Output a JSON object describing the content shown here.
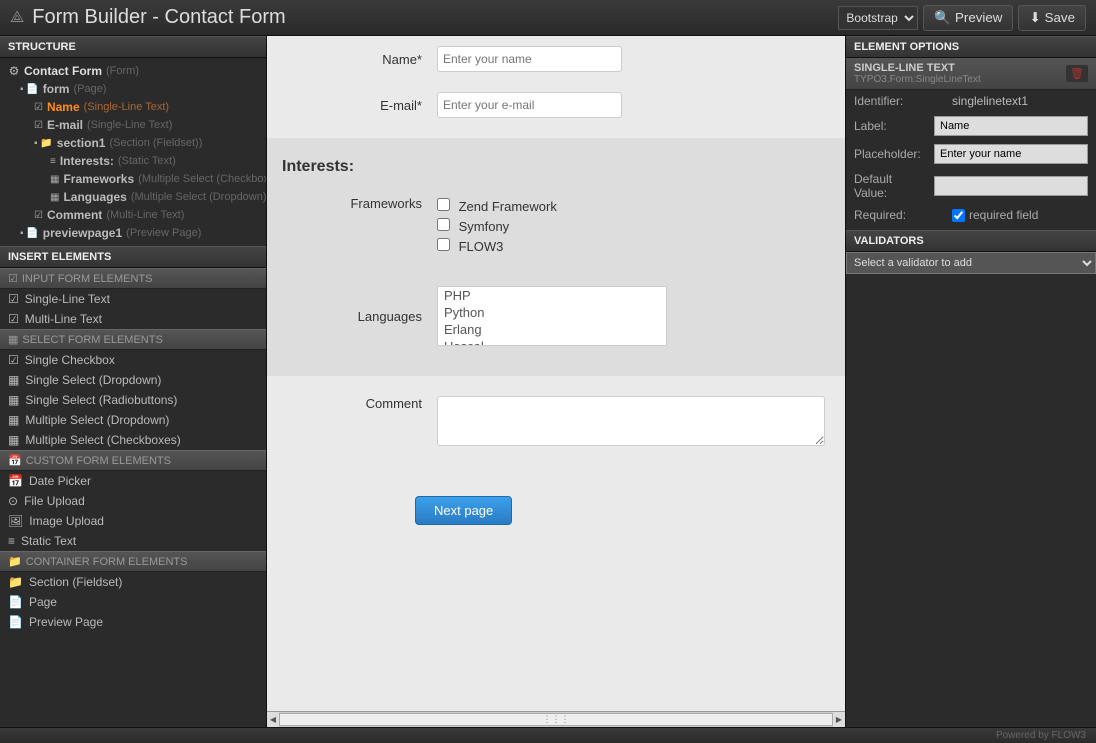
{
  "header": {
    "title": "Form Builder - Contact Form",
    "preset_selected": "Bootstrap",
    "preview_btn": "Preview",
    "save_btn": "Save"
  },
  "structure": {
    "title": "STRUCTURE",
    "root": {
      "label": "Contact Form",
      "type": "(Form)"
    },
    "items": [
      {
        "label": "form",
        "type": "(Page)",
        "indent": 1,
        "icon": "page"
      },
      {
        "label": "Name",
        "type": "(Single-Line Text)",
        "indent": 2,
        "icon": "text",
        "selected": true
      },
      {
        "label": "E-mail",
        "type": "(Single-Line Text)",
        "indent": 2,
        "icon": "text"
      },
      {
        "label": "section1",
        "type": "(Section (Fieldset))",
        "indent": 2,
        "icon": "folder"
      },
      {
        "label": "Interests:",
        "type": "(Static Text)",
        "indent": 3,
        "icon": "static"
      },
      {
        "label": "Frameworks",
        "type": "(Multiple Select (Checkboxes))",
        "indent": 3,
        "icon": "select"
      },
      {
        "label": "Languages",
        "type": "(Multiple Select (Dropdown))",
        "indent": 3,
        "icon": "select"
      },
      {
        "label": "Comment",
        "type": "(Multi-Line Text)",
        "indent": 2,
        "icon": "text"
      },
      {
        "label": "previewpage1",
        "type": "(Preview Page)",
        "indent": 1,
        "icon": "page"
      }
    ]
  },
  "insert": {
    "title": "INSERT ELEMENTS",
    "groups": [
      {
        "title": "INPUT FORM ELEMENTS",
        "items": [
          "Single-Line Text",
          "Multi-Line Text"
        ]
      },
      {
        "title": "SELECT FORM ELEMENTS",
        "items": [
          "Single Checkbox",
          "Single Select (Dropdown)",
          "Single Select (Radiobuttons)",
          "Multiple Select (Dropdown)",
          "Multiple Select (Checkboxes)"
        ]
      },
      {
        "title": "CUSTOM FORM ELEMENTS",
        "items": [
          "Date Picker",
          "File Upload",
          "Image Upload",
          "Static Text"
        ]
      },
      {
        "title": "CONTAINER FORM ELEMENTS",
        "items": [
          "Section (Fieldset)",
          "Page",
          "Preview Page"
        ]
      }
    ]
  },
  "canvas": {
    "name_label": "Name*",
    "name_placeholder": "Enter your name",
    "email_label": "E-mail*",
    "email_placeholder": "Enter your e-mail",
    "fieldset_legend": "Interests:",
    "frameworks_label": "Frameworks",
    "frameworks_options": [
      "Zend Framework",
      "Symfony",
      "FLOW3"
    ],
    "languages_label": "Languages",
    "languages_options": [
      "PHP",
      "Python",
      "Erlang",
      "Hascal"
    ],
    "comment_label": "Comment",
    "next_btn": "Next page"
  },
  "options": {
    "title": "ELEMENT OPTIONS",
    "element_type": "SINGLE-LINE TEXT",
    "element_class": "TYPO3.Form:SingleLineText",
    "rows": {
      "identifier_label": "Identifier:",
      "identifier_value": "singlelinetext1",
      "label_label": "Label:",
      "label_value": "Name",
      "placeholder_label": "Placeholder:",
      "placeholder_value": "Enter your name",
      "default_label": "Default Value:",
      "default_value": "",
      "required_label": "Required:",
      "required_check": "required field"
    },
    "validators_title": "VALIDATORS",
    "validators_placeholder": "Select a validator to add"
  },
  "footer": "Powered by FLOW3"
}
